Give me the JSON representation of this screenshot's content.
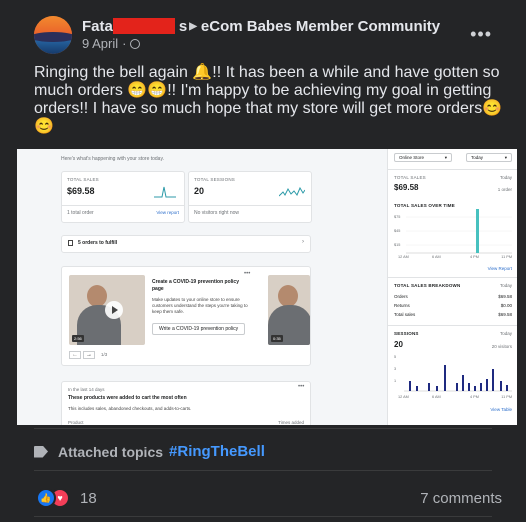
{
  "post": {
    "author_visible": "Fata",
    "author_suffix": "s",
    "group": "eCom Babes Member Community",
    "date": "9 April",
    "privacy_icon": "globe-icon",
    "more_icon": "ellipsis-icon",
    "text": "Ringing the bell again 🔔!! It has been a while and have gotten so much orders 😁😁!! I'm happy to be achieving my goal in getting orders!! I have so much hope that my store will get more orders😊😊"
  },
  "screenshot": {
    "greeting": "Here's what's happening with your store today.",
    "total_sales": {
      "label": "TOTAL SALES",
      "value": "$69.58",
      "sub": "1 total order",
      "link": "View report"
    },
    "total_sessions": {
      "label": "TOTAL SESSIONS",
      "value": "20",
      "sub": "No visitors right now"
    },
    "orders_to_fulfill": "5 orders to fulfill",
    "covid": {
      "title": "Create a COVID-19 prevention policy page",
      "body": "Make updates to your online store to ensure customers understand the steps you're taking to keep them safe.",
      "button": "Write a COVID-19 prevention policy",
      "duration_1": "2:56",
      "duration_2": "0:35",
      "pager": "1/3"
    },
    "products": {
      "meta": "In the last 14 days",
      "title": "These products were added to cart the most often",
      "body": "This includes sales, abandoned checkouts, and adds-to-carts.",
      "col1": "Product",
      "col2": "Times added"
    },
    "right": {
      "store_select": "Online Store",
      "date_select": "Today",
      "total_sales_label": "TOTAL SALES",
      "total_sales_when": "Today",
      "total_sales_value": "$69.58",
      "orders_count": "1 order",
      "over_time_label": "TOTAL SALES OVER TIME",
      "y_ticks": [
        "$75",
        "$45",
        "$15"
      ],
      "x_ticks": [
        "12 AM",
        "6 AM",
        "4 PM",
        "11 PM"
      ],
      "view_report": "View Report",
      "breakdown_label": "TOTAL SALES BREAKDOWN",
      "breakdown_when": "Today",
      "breakdown": [
        {
          "k": "Orders",
          "v": "$69.58"
        },
        {
          "k": "Returns",
          "v": "$0.00"
        },
        {
          "k": "Total sales",
          "v": "$69.58"
        }
      ],
      "sessions_label": "SESSIONS",
      "sessions_when": "Today",
      "sessions_value": "20",
      "visitors": "20 visitors",
      "s_y_ticks": [
        "5",
        "3",
        "1"
      ],
      "s_x_ticks": [
        "12 AM",
        "6 AM",
        "4 PM",
        "11 PM"
      ],
      "view_table": "View Table"
    }
  },
  "attached": {
    "label": "Attached topics",
    "tag": "#RingTheBell",
    "icon": "tag-icon"
  },
  "footer": {
    "reactions": "18",
    "comments": "7 comments",
    "like_icon": "thumbs-up-icon",
    "love_icon": "heart-icon"
  }
}
